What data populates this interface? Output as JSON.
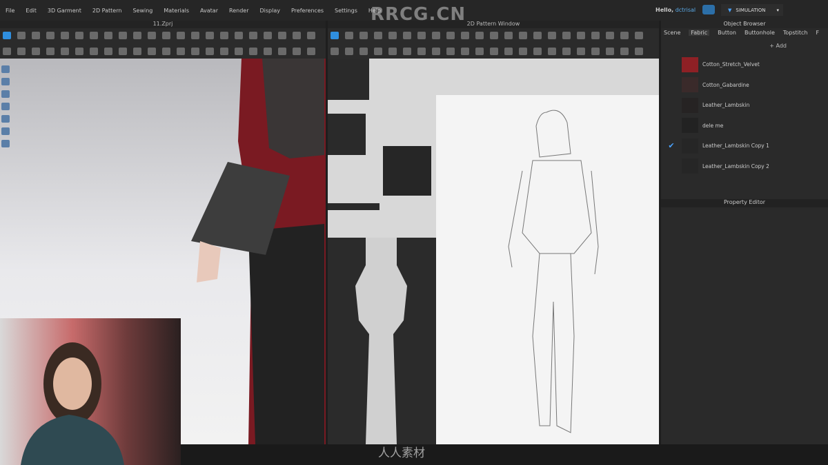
{
  "menu": [
    "File",
    "Edit",
    "3D Garment",
    "2D Pattern",
    "Sewing",
    "Materials",
    "Avatar",
    "Render",
    "Display",
    "Preferences",
    "Settings",
    "Help"
  ],
  "watermark_top": "RRCG.CN",
  "watermark_bottom": "人人素材",
  "user": {
    "greeting": "Hello,",
    "name": "dctrisal"
  },
  "mode": "SIMULATION",
  "view3d_title": "11.Zprj",
  "view2d_title": "2D Pattern Window",
  "object_browser": {
    "title": "Object Browser",
    "tabs": [
      "Scene",
      "Fabric",
      "Button",
      "Buttonhole",
      "Topstitch",
      "F"
    ],
    "active_tab": "Fabric",
    "add_label": "+ Add",
    "fabrics": [
      {
        "name": "Cotton_Stretch_Velvet",
        "color": "#8e2025",
        "checked": false
      },
      {
        "name": "Cotton_Gabardine",
        "color": "#3a2a2a",
        "checked": false
      },
      {
        "name": "Leather_Lambskin",
        "color": "#262323",
        "checked": false
      },
      {
        "name": "dele me",
        "color": "#222",
        "checked": false
      },
      {
        "name": "Leather_Lambskin Copy 1",
        "color": "#262626",
        "checked": true
      },
      {
        "name": "Leather_Lambskin Copy 2",
        "color": "#262626",
        "checked": false
      }
    ]
  },
  "property_editor": "Property Editor",
  "colors": {
    "accent": "#2f8fe0",
    "panel": "#2a2a2a"
  }
}
